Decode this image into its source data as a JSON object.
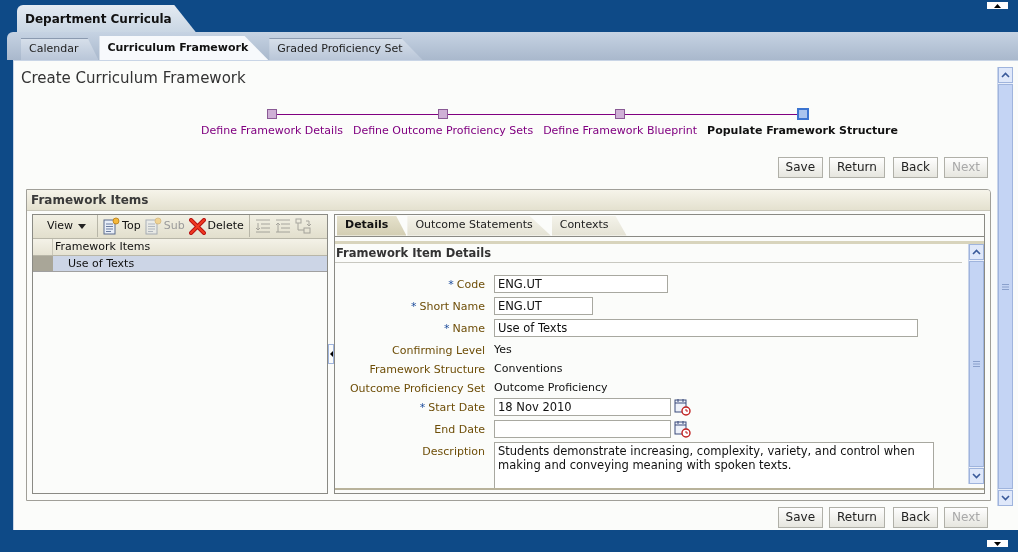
{
  "app_tab": {
    "label": "Department Curricula"
  },
  "tabs": [
    {
      "label": "Calendar",
      "selected": false
    },
    {
      "label": "Curriculum Framework",
      "selected": true
    },
    {
      "label": "Graded Proficiency Set",
      "selected": false
    }
  ],
  "page_title": "Create Curriculum Framework",
  "train": [
    {
      "label": "Define Framework Details",
      "selected": false
    },
    {
      "label": "Define Outcome Proficiency Sets",
      "selected": false
    },
    {
      "label": "Define Framework Blueprint",
      "selected": false
    },
    {
      "label": "Populate Framework Structure",
      "selected": true
    }
  ],
  "buttons_top": [
    {
      "label": "Save",
      "disabled": false
    },
    {
      "label": "Return",
      "disabled": false
    },
    {
      "label": "Back",
      "disabled": false
    },
    {
      "label": "Next",
      "disabled": true
    }
  ],
  "framework_items": {
    "title": "Framework Items",
    "toolbar": [
      {
        "kind": "menu",
        "label": "View",
        "disabled": false
      },
      {
        "kind": "add",
        "label": "Top",
        "disabled": false
      },
      {
        "kind": "add",
        "label": "Sub",
        "disabled": true
      },
      {
        "kind": "delete",
        "label": "Delete",
        "disabled": false
      },
      {
        "kind": "indent",
        "disabled": true
      },
      {
        "kind": "outdent",
        "disabled": true
      },
      {
        "kind": "move",
        "disabled": true
      }
    ],
    "tree": {
      "column": "Framework Items",
      "rows": [
        {
          "label": "Use of Texts",
          "selected": true
        }
      ]
    }
  },
  "detail_tabs": [
    {
      "label": "Details",
      "selected": true
    },
    {
      "label": "Outcome Statements",
      "selected": false
    },
    {
      "label": "Contexts",
      "selected": false
    }
  ],
  "details": {
    "title": "Framework Item Details",
    "fields": [
      {
        "kind": "text",
        "required_mark": "*",
        "label": "Code",
        "value": "ENG.UT"
      },
      {
        "kind": "short",
        "required_mark": "*",
        "label": "Short Name",
        "value": "ENG.UT"
      },
      {
        "kind": "long",
        "required_mark": "*",
        "label": "Name",
        "value": "Use of Texts"
      },
      {
        "kind": "readonly",
        "label": "Confirming Level",
        "value": "Yes"
      },
      {
        "kind": "readonly",
        "label": "Framework Structure",
        "value": "Conventions"
      },
      {
        "kind": "readonly",
        "label": "Outcome Proficiency Set",
        "value": "Outcome Proficiency"
      },
      {
        "kind": "date",
        "required_mark": "*",
        "label": "Start Date",
        "value": "18 Nov 2010"
      },
      {
        "kind": "date",
        "label": "End Date"
      },
      {
        "kind": "textarea",
        "label": "Description",
        "value": "Students demonstrate increasing, complexity, variety, and control when making and conveying meaning with spoken texts."
      }
    ]
  },
  "buttons_bottom": [
    {
      "label": "Save",
      "disabled": false
    },
    {
      "label": "Return",
      "disabled": false
    },
    {
      "label": "Back",
      "disabled": false
    },
    {
      "label": "Next",
      "disabled": true
    }
  ]
}
